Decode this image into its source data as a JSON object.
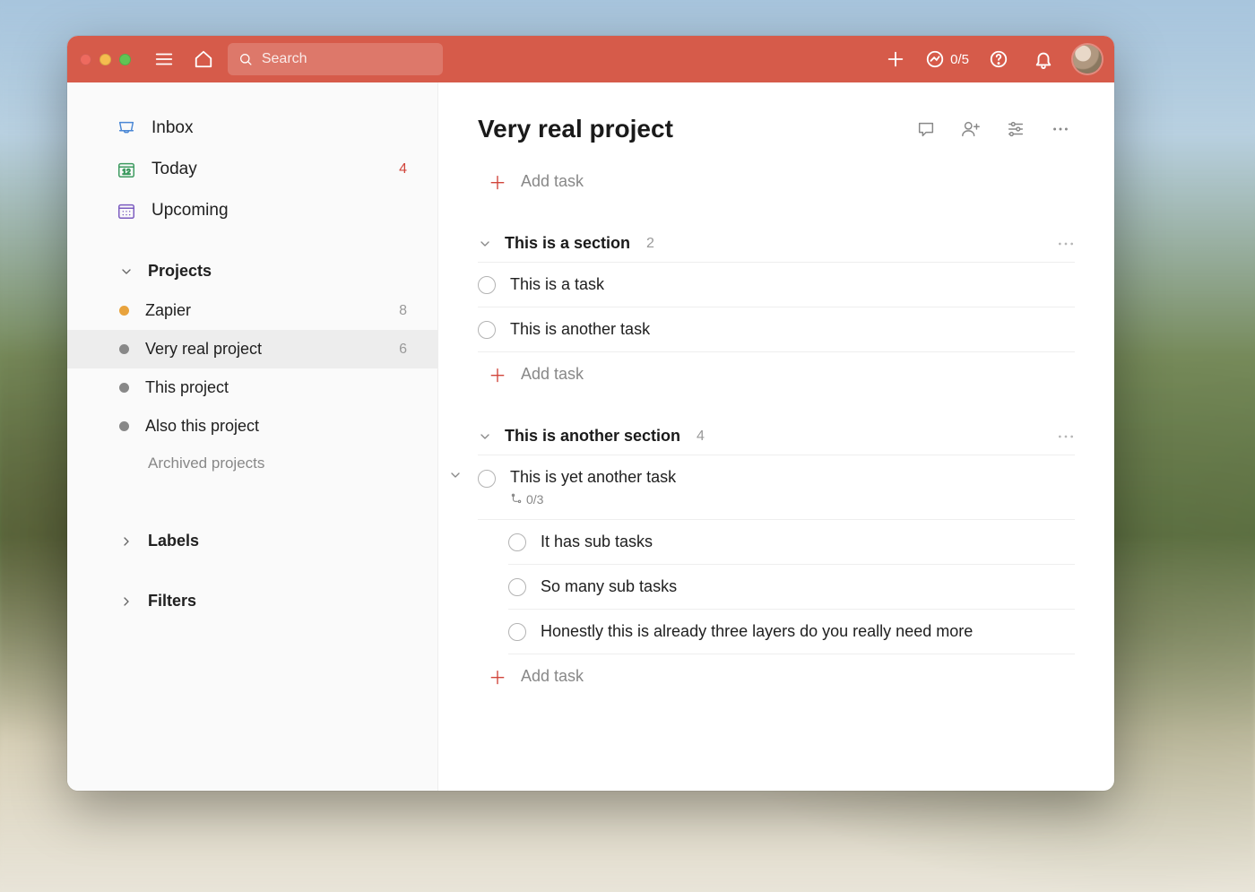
{
  "titlebar": {
    "search_placeholder": "Search",
    "goal_count": "0/5"
  },
  "sidebar": {
    "nav": [
      {
        "label": "Inbox",
        "count": ""
      },
      {
        "label": "Today",
        "count": "4"
      },
      {
        "label": "Upcoming",
        "count": ""
      }
    ],
    "projects_label": "Projects",
    "projects": [
      {
        "label": "Zapier",
        "count": "8",
        "color": "orange",
        "active": false
      },
      {
        "label": "Very real project",
        "count": "6",
        "color": "grey",
        "active": true
      },
      {
        "label": "This project",
        "count": "",
        "color": "grey",
        "active": false
      },
      {
        "label": "Also this project",
        "count": "",
        "color": "grey",
        "active": false
      }
    ],
    "archived_label": "Archived projects",
    "labels_label": "Labels",
    "filters_label": "Filters"
  },
  "main": {
    "project_title": "Very real project",
    "add_task_label": "Add task",
    "sections": [
      {
        "title": "This is a section",
        "count": "2",
        "tasks": [
          {
            "title": "This is a task"
          },
          {
            "title": "This is another task"
          }
        ]
      },
      {
        "title": "This is another section",
        "count": "4",
        "tasks": [
          {
            "title": "This is yet another task",
            "subtask_progress": "0/3",
            "subtasks": [
              {
                "title": "It has sub tasks"
              },
              {
                "title": "So many sub tasks"
              },
              {
                "title": "Honestly this is already three layers do you really need more"
              }
            ]
          }
        ]
      }
    ]
  }
}
